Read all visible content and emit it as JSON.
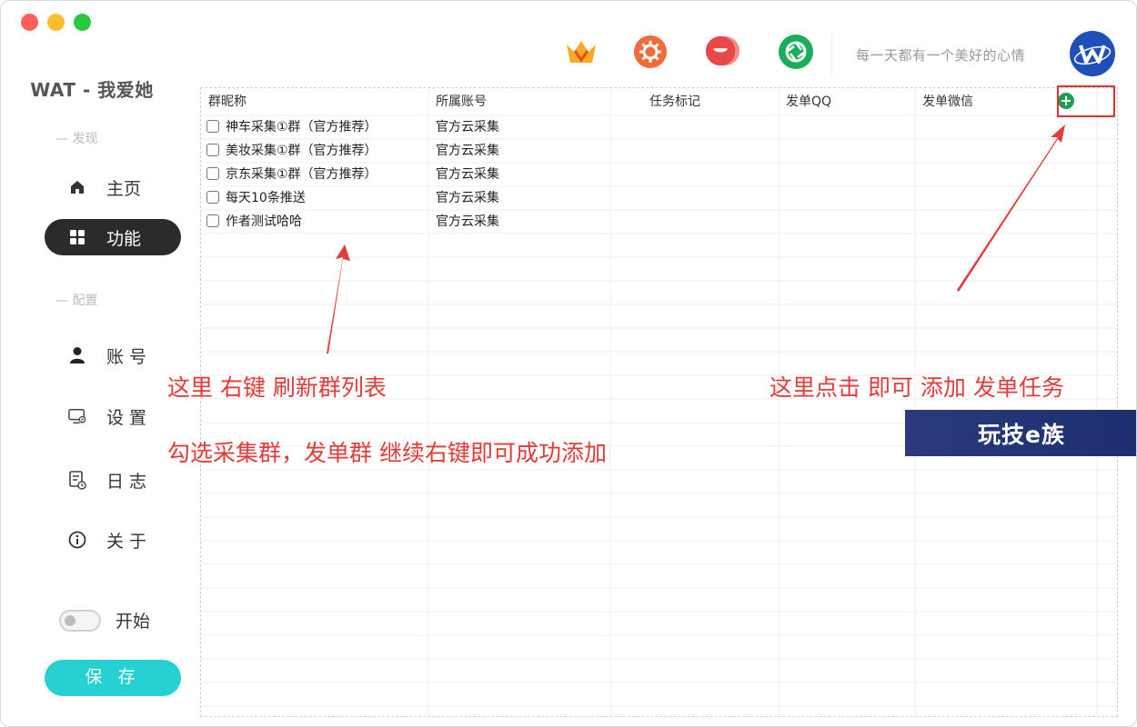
{
  "app": {
    "title": "WAT - 我爱她",
    "motto": "每一天都有一个美好的心情"
  },
  "sidebar": {
    "sections": [
      {
        "label": "— 发现"
      },
      {
        "label": "— 配置"
      }
    ],
    "items": [
      {
        "label": "主页",
        "icon": "home-icon"
      },
      {
        "label": "功能",
        "icon": "grid-icon",
        "active": true
      },
      {
        "label": "账 号",
        "icon": "user-icon"
      },
      {
        "label": "设 置",
        "icon": "monitor-settings-icon"
      },
      {
        "label": "日 志",
        "icon": "log-icon"
      },
      {
        "label": "关 于",
        "icon": "info-icon"
      }
    ],
    "toggle_label": "开始",
    "toggle_on": false,
    "save_label": "保 存"
  },
  "header_icons": [
    {
      "name": "crown-vip-icon",
      "color": "#f7a928"
    },
    {
      "name": "orange-settings-icon",
      "color": "#f26b3a"
    },
    {
      "name": "red-chat-icon",
      "color": "#e8484a"
    },
    {
      "name": "green-aperture-icon",
      "color": "#1aad5a"
    }
  ],
  "table": {
    "columns": [
      "群昵称",
      "所属账号",
      "任务标记",
      "发单QQ",
      "发单微信"
    ],
    "rows": [
      {
        "name": "神车采集①群（官方推荐）",
        "account": "官方云采集",
        "checked": false
      },
      {
        "name": "美妆采集①群（官方推荐）",
        "account": "官方云采集",
        "checked": false
      },
      {
        "name": "京东采集①群（官方推荐）",
        "account": "官方云采集",
        "checked": false
      },
      {
        "name": "每天10条推送",
        "account": "官方云采集",
        "checked": false
      },
      {
        "name": "作者测试哈哈",
        "account": "官方云采集",
        "checked": false
      }
    ],
    "add_label": "+"
  },
  "annotations": {
    "left_line1": "这里 右键 刷新群列表",
    "left_line2": "勾选采集群，发单群 继续右键即可成功添加",
    "right_line1": "这里点击 即可 添加 发单任务",
    "watermark": "玩技e族"
  },
  "colors": {
    "accent": "#26d1d4",
    "active_nav": "#2b2b2b",
    "annotation": "#e53a35",
    "add_button": "#1f9d55"
  }
}
